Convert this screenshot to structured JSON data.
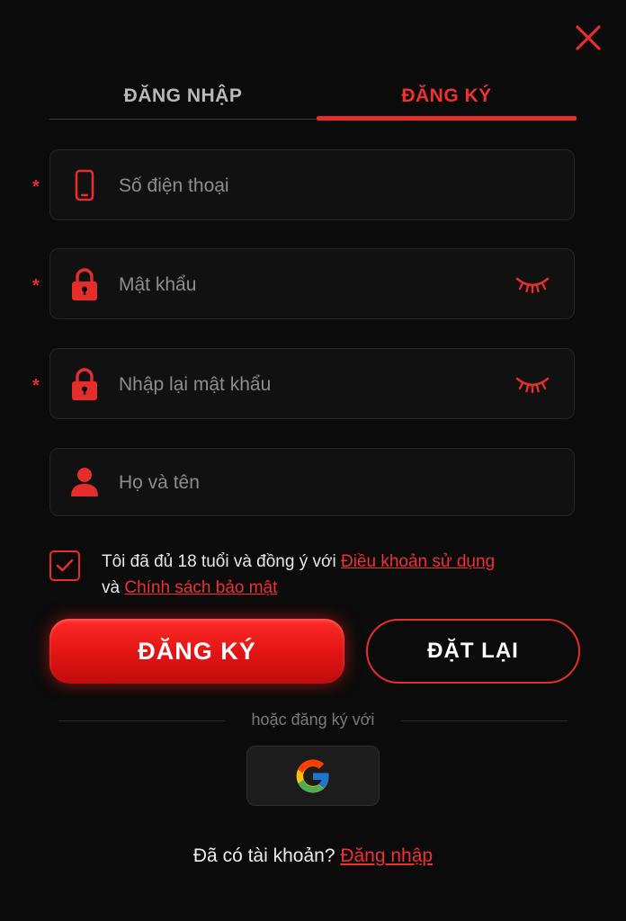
{
  "tabs": {
    "login_label": "ĐĂNG NHẬP",
    "register_label": "ĐĂNG KÝ",
    "active": "register"
  },
  "form": {
    "phone": {
      "placeholder": "Số điện thoại",
      "value": "",
      "required": true,
      "icon": "phone-icon"
    },
    "password": {
      "placeholder": "Mật khẩu",
      "value": "",
      "required": true,
      "icon": "lock-icon"
    },
    "confirm_password": {
      "placeholder": "Nhập lại mật khẩu",
      "value": "",
      "required": true,
      "icon": "lock-icon"
    },
    "full_name": {
      "placeholder": "Họ và tên",
      "value": "",
      "required": false,
      "icon": "user-icon"
    },
    "required_mark": "*"
  },
  "agreement": {
    "checked": true,
    "text_before": "Tôi đã đủ 18 tuổi và đồng ý với ",
    "terms_link": "Điều khoản sử dụng",
    "text_middle": "và ",
    "privacy_link": "Chính sách bảo mật"
  },
  "buttons": {
    "register": "ĐĂNG KÝ",
    "reset": "ĐẶT LẠI"
  },
  "social": {
    "divider_text": "hoặc đăng ký với",
    "google_icon": "google-icon"
  },
  "footer": {
    "question": "Đã có tài khoản? ",
    "login_link": "Đăng nhập"
  },
  "colors": {
    "background": "#0b0b0b",
    "accent": "#e82d2b",
    "field_bg": "#111111",
    "muted_text": "#8d8d8d"
  }
}
